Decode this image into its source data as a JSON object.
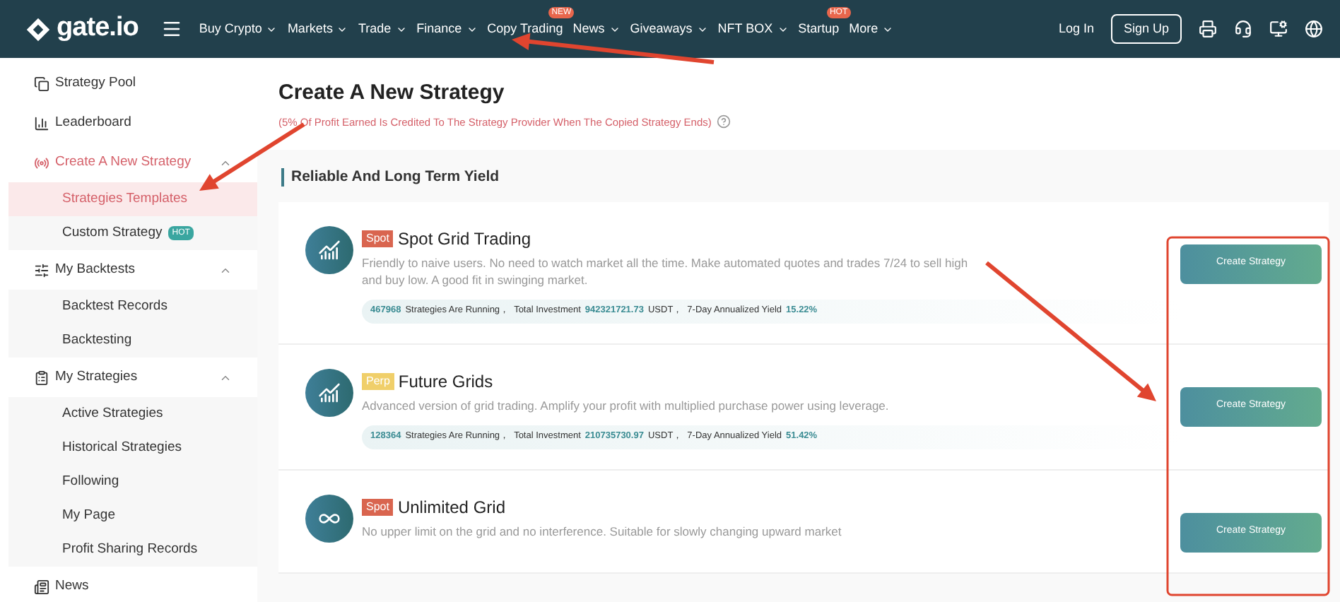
{
  "nav": {
    "logo": "gate.io",
    "items": [
      {
        "label": "Buy Crypto",
        "dropdown": true
      },
      {
        "label": "Markets",
        "dropdown": true
      },
      {
        "label": "Trade",
        "dropdown": true
      },
      {
        "label": "Finance",
        "dropdown": true
      },
      {
        "label": "Copy Trading",
        "dropdown": false,
        "badge": "NEW"
      },
      {
        "label": "News",
        "dropdown": true
      },
      {
        "label": "Giveaways",
        "dropdown": true
      },
      {
        "label": "NFT BOX",
        "dropdown": true
      },
      {
        "label": "Startup",
        "dropdown": false,
        "badge": "HOT"
      },
      {
        "label": "More",
        "dropdown": true
      }
    ],
    "login": "Log In",
    "signup": "Sign Up"
  },
  "sidebar": {
    "items": [
      {
        "label": "Strategy Pool",
        "selected": false
      },
      {
        "label": "Leaderboard",
        "selected": false
      },
      {
        "label": "Create A New Strategy",
        "selected": true,
        "expanded": true,
        "children": [
          {
            "label": "Strategies Templates",
            "selected": true
          },
          {
            "label": "Custom Strategy",
            "selected": false,
            "badge": "HOT"
          }
        ]
      },
      {
        "label": "My Backtests",
        "selected": false,
        "expanded": true,
        "children": [
          {
            "label": "Backtest Records",
            "selected": false
          },
          {
            "label": "Backtesting",
            "selected": false
          }
        ]
      },
      {
        "label": "My Strategies",
        "selected": false,
        "expanded": true,
        "children": [
          {
            "label": "Active Strategies",
            "selected": false
          },
          {
            "label": "Historical Strategies",
            "selected": false
          },
          {
            "label": "Following",
            "selected": false
          },
          {
            "label": "My Page",
            "selected": false
          },
          {
            "label": "Profit Sharing Records",
            "selected": false
          }
        ]
      },
      {
        "label": "News",
        "selected": false
      }
    ]
  },
  "main": {
    "title": "Create A New Strategy",
    "note": "(5% Of Profit Earned Is Credited To The Strategy Provider When The Copied Strategy Ends)",
    "section": "Reliable And Long Term Yield",
    "strategies": [
      {
        "tag": {
          "text": "Spot",
          "color": "#d9654f"
        },
        "name": "Spot Grid Trading",
        "description": "Friendly to naive users. No need to watch market all the time. Make automated quotes and trades 7/24 to sell high and buy low. A good fit in swinging market.",
        "stats": [
          {
            "kind": "value",
            "text": "467968"
          },
          {
            "kind": "label",
            "text": "Strategies Are Running，"
          },
          {
            "kind": "label",
            "text": "Total Investment"
          },
          {
            "kind": "value",
            "text": "942321721.73"
          },
          {
            "kind": "label",
            "text": "USDT，"
          },
          {
            "kind": "label",
            "text": "7-Day Annualized Yield"
          },
          {
            "kind": "value",
            "text": "15.22%"
          }
        ],
        "button": "Create Strategy"
      },
      {
        "tag": {
          "text": "Perp",
          "color": "#f0cf6a"
        },
        "name": "Future Grids",
        "description": "Advanced version of grid trading. Amplify your profit with multiplied purchase power using leverage.",
        "stats": [
          {
            "kind": "value",
            "text": "128364"
          },
          {
            "kind": "label",
            "text": "Strategies Are Running，"
          },
          {
            "kind": "label",
            "text": "Total Investment"
          },
          {
            "kind": "value",
            "text": "210735730.97"
          },
          {
            "kind": "label",
            "text": "USDT，"
          },
          {
            "kind": "label",
            "text": "7-Day Annualized Yield"
          },
          {
            "kind": "value",
            "text": "51.42%"
          }
        ],
        "button": "Create Strategy"
      },
      {
        "tag": {
          "text": "Spot",
          "color": "#d9654f"
        },
        "name": "Unlimited Grid",
        "description": "No upper limit on the grid and no interference. Suitable for slowly changing upward market",
        "button": "Create Strategy"
      }
    ]
  }
}
